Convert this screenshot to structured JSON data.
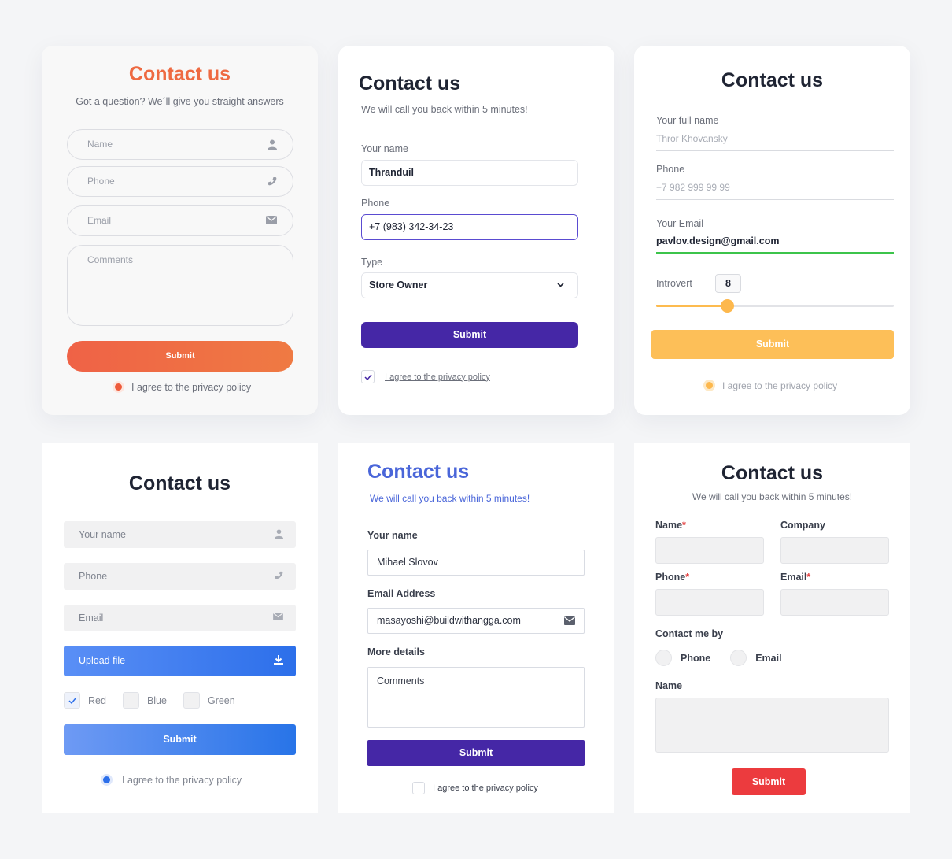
{
  "card1": {
    "title": "Contact us",
    "subtitle": "Got a question? We´ll give you straight answers",
    "name_placeholder": "Name",
    "phone_placeholder": "Phone",
    "email_placeholder": "Email",
    "comments_placeholder": "Comments",
    "submit_label": "Submit",
    "agree_label": "I agree to the privacy policy",
    "accent": "#ee6a42"
  },
  "card2": {
    "title": "Contact us",
    "subtitle": "We will call you back within 5 minutes!",
    "name_label": "Your name",
    "name_value": "Thranduil",
    "phone_label": "Phone",
    "phone_value": "+7 (983) 342-34-23",
    "type_label": "Type",
    "type_value": "Store Owner",
    "submit_label": "Submit",
    "agree_label": "I agree to the privacy policy",
    "agree_checked": true,
    "accent": "#4527a6"
  },
  "card3": {
    "title": "Contact us",
    "name_label": "Your full name",
    "name_value": "Thror Khovansky",
    "phone_label": "Phone",
    "phone_value": "+7 982 999 99 99",
    "email_label": "Your Email",
    "email_value": "pavlov.design@gmail.com",
    "slider_label": "Introvert",
    "slider_value": "8",
    "slider_fraction": 0.3,
    "submit_label": "Submit",
    "agree_label": "I agree to the privacy policy",
    "accent": "#fdbf58"
  },
  "card4": {
    "title": "Contact us",
    "name_placeholder": "Your name",
    "phone_placeholder": "Phone",
    "email_placeholder": "Email",
    "upload_label": "Upload file",
    "checks": [
      {
        "label": "Red",
        "checked": true
      },
      {
        "label": "Blue",
        "checked": false
      },
      {
        "label": "Green",
        "checked": false
      }
    ],
    "submit_label": "Submit",
    "agree_label": "I agree to the privacy policy",
    "accent": "#2c6fea"
  },
  "card5": {
    "title": "Contact us",
    "subtitle": "We will call you back within 5 minutes!",
    "name_label": "Your name",
    "name_value": "Mihael Slovov",
    "email_label": "Email Address",
    "email_value": "masayoshi@buildwithangga.com",
    "details_label": "More details",
    "comments_placeholder": "Comments",
    "submit_label": "Submit",
    "agree_label": "I agree to the privacy policy",
    "agree_checked": false,
    "accent": "#4a66d9"
  },
  "card6": {
    "title": "Contact us",
    "subtitle": "We will call you back within 5 minutes!",
    "name_label": "Name",
    "company_label": "Company",
    "phone_label": "Phone",
    "email_label": "Email",
    "required_mark": "*",
    "contact_by_label": "Contact me by",
    "contact_options": [
      "Phone",
      "Email"
    ],
    "message_label": "Name",
    "submit_label": "Submit",
    "accent": "#ec3b3e"
  }
}
